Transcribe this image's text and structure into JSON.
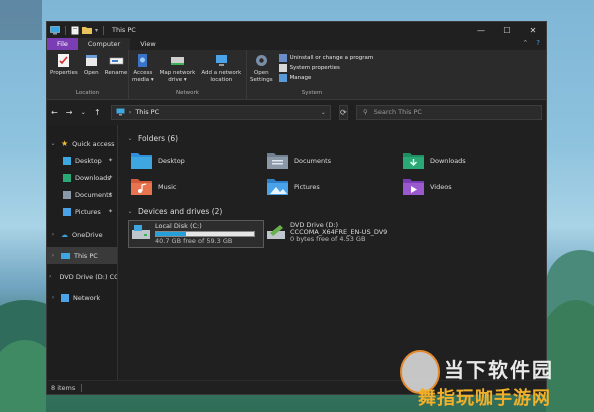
{
  "window": {
    "title": "This PC",
    "controls": {
      "minimize": "—",
      "maximize": "☐",
      "close": "✕"
    }
  },
  "ribbon_tabs": [
    "File",
    "Computer",
    "View"
  ],
  "ribbon": {
    "location": {
      "label": "Location",
      "buttons": [
        "Properties",
        "Open",
        "Rename"
      ]
    },
    "network": {
      "label": "Network",
      "buttons": [
        {
          "line1": "Access",
          "line2": "media ▾"
        },
        {
          "line1": "Map network",
          "line2": "drive ▾"
        },
        {
          "line1": "Add a network",
          "line2": "location"
        }
      ]
    },
    "system": {
      "label": "System",
      "open_settings": {
        "line1": "Open",
        "line2": "Settings"
      },
      "list": [
        "Uninstall or change a program",
        "System properties",
        "Manage"
      ]
    }
  },
  "address": {
    "path": "This PC",
    "search_placeholder": "Search This PC"
  },
  "nav": {
    "quick_access": "Quick access",
    "items": [
      "Desktop",
      "Downloads",
      "Documents",
      "Pictures"
    ],
    "onedrive": "OneDrive",
    "this_pc": "This PC",
    "dvd": "DVD Drive (D:) CCCO",
    "network": "Network"
  },
  "folders": {
    "header": "Folders (6)",
    "items": [
      "Desktop",
      "Documents",
      "Downloads",
      "Music",
      "Pictures",
      "Videos"
    ]
  },
  "drives": {
    "header": "Devices and drives (2)",
    "local": {
      "name": "Local Disk (C:)",
      "free": "40.7 GB free of 59.3 GB",
      "used_fraction": 0.31
    },
    "dvd": {
      "name": "DVD Drive (D:)",
      "label": "CCCOMA_X64FRE_EN-US_DV9",
      "free": "0 bytes free of 4.53 GB"
    }
  },
  "status": {
    "items": "8 items"
  },
  "watermark": {
    "line1": "当下软件园",
    "line2": "舞指玩咖手游网"
  },
  "colors": {
    "accent_file_tab": "#7a3db3",
    "progress": "#26a0da"
  }
}
